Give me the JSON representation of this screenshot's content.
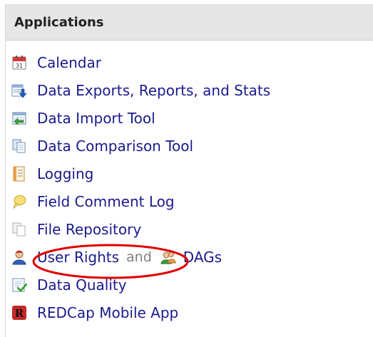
{
  "panel": {
    "title": "Applications"
  },
  "items": [
    {
      "label": "Calendar",
      "icon": "calendar-icon"
    },
    {
      "label": "Data Exports, Reports, and Stats",
      "icon": "data-exports-icon"
    },
    {
      "label": "Data Import Tool",
      "icon": "data-import-icon"
    },
    {
      "label": "Data Comparison Tool",
      "icon": "data-comparison-icon"
    },
    {
      "label": "Logging",
      "icon": "logging-icon"
    },
    {
      "label": "Field Comment Log",
      "icon": "comment-bubble-icon"
    },
    {
      "label": "File Repository",
      "icon": "file-repository-icon"
    },
    {
      "label": "User Rights",
      "icon": "user-rights-icon",
      "separator": "and",
      "secondary_label": "DAGs",
      "secondary_icon": "users-group-icon"
    },
    {
      "label": "Data Quality",
      "icon": "data-quality-icon"
    },
    {
      "label": "REDCap Mobile App",
      "icon": "redcap-mobile-app-icon"
    }
  ],
  "colors": {
    "link": "#1a1a8c",
    "header_bg": "#e6e6e6",
    "annotation": "#e00000"
  }
}
